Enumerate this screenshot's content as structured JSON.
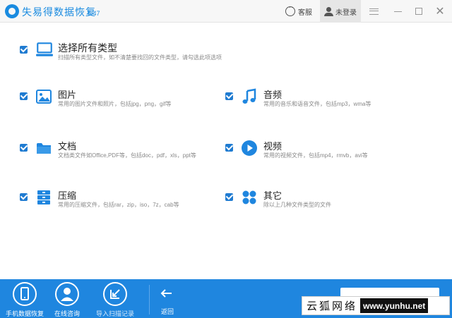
{
  "titlebar": {
    "app_title": "失易得数据恢复",
    "version": "6.47",
    "service_label": "客服",
    "user_label": "未登录"
  },
  "options": [
    {
      "id": "all",
      "title": "选择所有类型",
      "desc": "扫描所有类型文件，如不清楚要找回的文件类型，请勾选此项选项",
      "checked": true,
      "icon": "computer-icon"
    },
    {
      "id": "image",
      "title": "图片",
      "desc": "常用的图片文件和照片，包括jpg，png，gif等",
      "checked": true,
      "icon": "image-icon"
    },
    {
      "id": "audio",
      "title": "音频",
      "desc": "常用的音乐和语音文件，包括mp3，wma等",
      "checked": true,
      "icon": "music-note-icon"
    },
    {
      "id": "document",
      "title": "文档",
      "desc": "文档类文件如Office,PDF等，包括doc，pdf，xls，ppt等",
      "checked": true,
      "icon": "folder-icon"
    },
    {
      "id": "video",
      "title": "视频",
      "desc": "常用的视频文件，包括mp4，rmvb，avi等",
      "checked": true,
      "icon": "play-icon"
    },
    {
      "id": "archive",
      "title": "压缩",
      "desc": "常用的压缩文件，包括rar，zip，iso，7z，cab等",
      "checked": true,
      "icon": "archive-icon"
    },
    {
      "id": "other",
      "title": "其它",
      "desc": "除以上几种文件类型的文件",
      "checked": true,
      "icon": "grid-icon"
    }
  ],
  "footer": {
    "phone_recovery": "手机数据恢复",
    "online_consult": "在线咨询",
    "import_scan": "导入扫描记录",
    "back": "返回"
  },
  "watermark": {
    "cn": "云狐网络",
    "url": "www.yunhu.net"
  },
  "colors": {
    "accent": "#1a8be0",
    "footer": "#1f86df",
    "checkbox": "#1f7bd1"
  }
}
